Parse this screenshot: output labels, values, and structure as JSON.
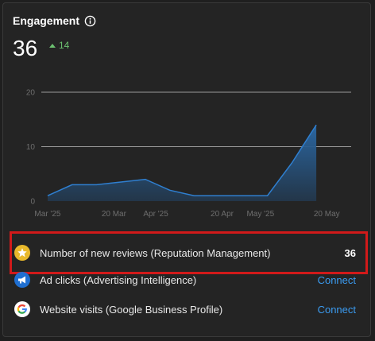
{
  "widget": {
    "title": "Engagement",
    "value": "36",
    "delta": "14"
  },
  "chart_data": {
    "type": "area",
    "x_ticks": [
      "Mar '25",
      "20 Mar",
      "Apr '25",
      "20 Apr",
      "May '25",
      "20 May"
    ],
    "y_ticks": [
      "0",
      "10",
      "20"
    ],
    "ylim": [
      0,
      20
    ],
    "x": [
      "2025-03-01",
      "2025-03-08",
      "2025-03-15",
      "2025-03-22",
      "2025-03-29",
      "2025-04-05",
      "2025-04-12",
      "2025-04-19",
      "2025-04-26",
      "2025-05-03",
      "2025-05-10",
      "2025-05-17"
    ],
    "values": [
      1,
      3,
      3,
      3.5,
      4,
      2,
      1,
      1,
      1,
      1,
      7,
      14
    ],
    "grid": true,
    "colors": {
      "line": "#2f7fd0",
      "fill_top": "#2b6aa8",
      "fill_bottom": "#23384d"
    }
  },
  "rows": [
    {
      "icon": "star-icon",
      "label": "Number of new reviews (Reputation Management)",
      "value": "36"
    },
    {
      "icon": "megaphone-icon",
      "label": "Ad clicks (Advertising Intelligence)",
      "action": "Connect"
    },
    {
      "icon": "google-icon",
      "label": "Website visits (Google Business Profile)",
      "action": "Connect"
    }
  ]
}
